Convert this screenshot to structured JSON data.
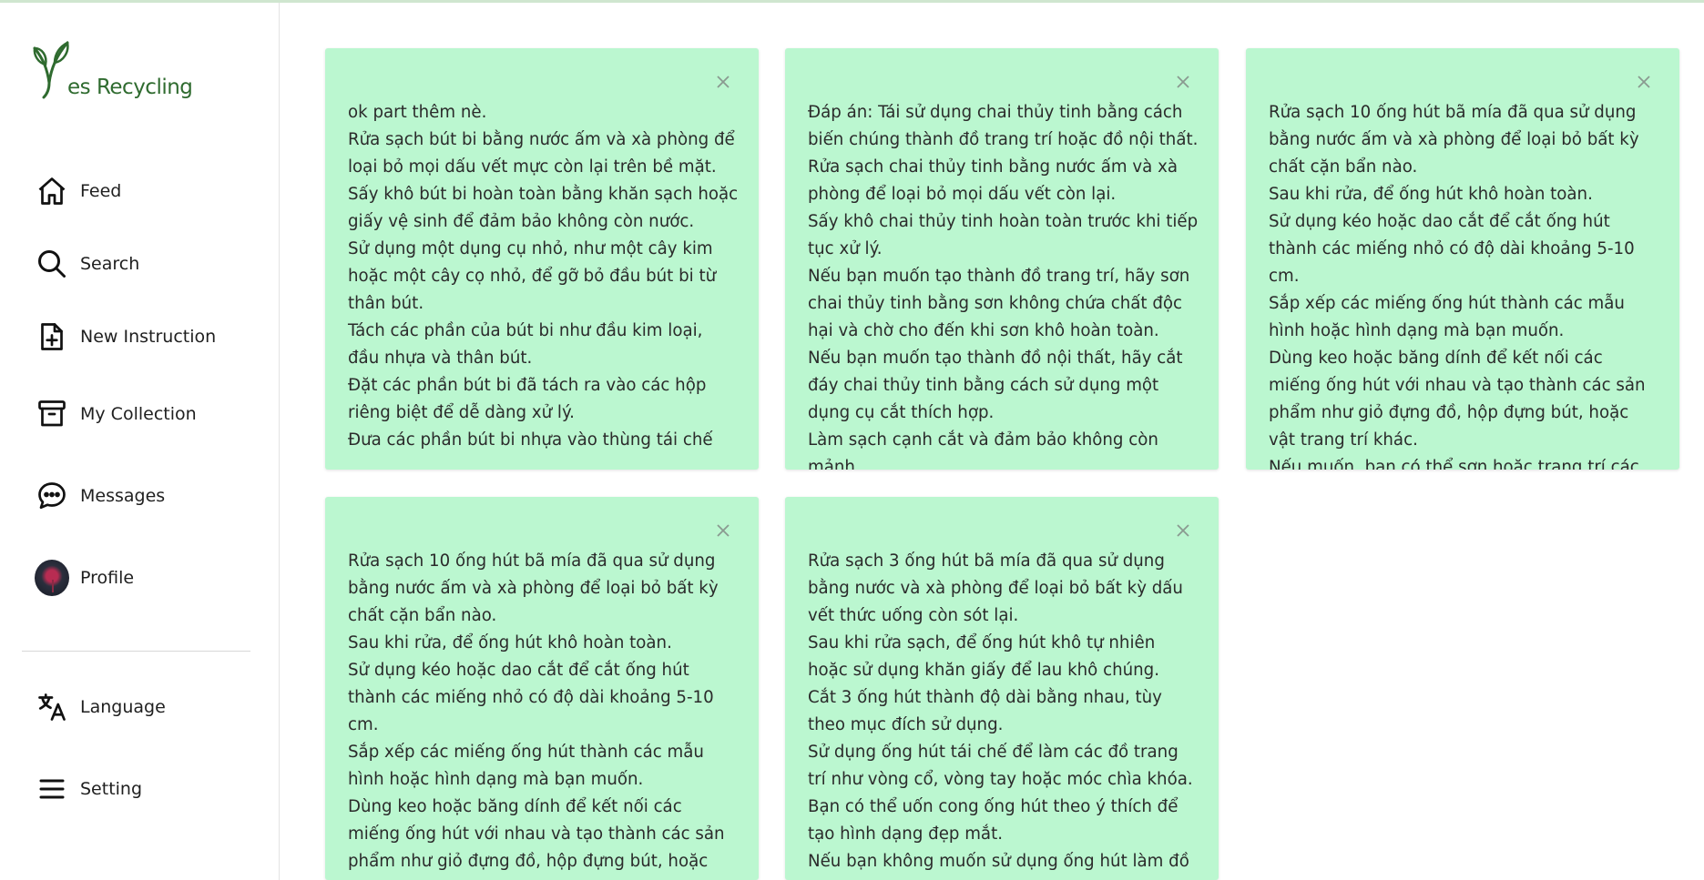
{
  "app": {
    "logo_text": "es Recycling",
    "brand_color": "#2f6b2f",
    "card_color": "#bbf7d0"
  },
  "sidebar": {
    "items": [
      {
        "label": "Feed",
        "icon": "home-icon"
      },
      {
        "label": "Search",
        "icon": "search-icon"
      },
      {
        "label": "New Instruction",
        "icon": "file-plus-icon"
      },
      {
        "label": "My Collection",
        "icon": "archive-icon"
      },
      {
        "label": "Messages",
        "icon": "chat-bubble-icon"
      },
      {
        "label": "Profile",
        "icon": "avatar"
      },
      {
        "label": "Language",
        "icon": "translate-icon"
      },
      {
        "label": "Setting",
        "icon": "menu-icon"
      }
    ]
  },
  "cards": [
    {
      "lines": [
        "ok part thêm nè.",
        "Rửa sạch bút bi bằng nước ấm và xà phòng để loại bỏ mọi dấu vết mực còn lại trên bề mặt.",
        "Sấy khô bút bi hoàn toàn bằng khăn sạch hoặc giấy vệ sinh để đảm bảo không còn nước.",
        "Sử dụng một dụng cụ nhỏ, như một cây kim hoặc một cây cọ nhỏ, để gỡ bỏ đầu bút bi từ thân bút.",
        "Tách các phần của bút bi như đầu kim loại, đầu nhựa và thân bút.",
        "Đặt các phần bút bi đã tách ra vào các hộp riêng biệt để dễ dàng xử lý.",
        "Đưa các phần bút bi nhựa vào thùng tái chế"
      ]
    },
    {
      "lines": [
        "Đáp án: Tái sử dụng chai thủy tinh bằng cách biến chúng thành đồ trang trí hoặc đồ nội thất.",
        "Rửa sạch chai thủy tinh bằng nước ấm và xà phòng để loại bỏ mọi dấu vết còn lại.",
        "Sấy khô chai thủy tinh hoàn toàn trước khi tiếp tục xử lý.",
        "Nếu bạn muốn tạo thành đồ trang trí, hãy sơn chai thủy tinh bằng sơn không chứa chất độc hại và chờ cho đến khi sơn khô hoàn toàn.",
        "Nếu bạn muốn tạo thành đồ nội thất, hãy cắt đáy chai thủy tinh bằng cách sử dụng một dụng cụ cắt thích hợp.",
        "Làm sạch cạnh cắt và đảm bảo không còn mảnh"
      ]
    },
    {
      "lines": [
        "Rửa sạch 10 ống hút bã mía đã qua sử dụng bằng nước ấm và xà phòng để loại bỏ bất kỳ chất cặn bẩn nào.",
        "Sau khi rửa, để ống hút khô hoàn toàn.",
        "Sử dụng kéo hoặc dao cắt để cắt ống hút thành các miếng nhỏ có độ dài khoảng 5-10 cm.",
        "Sắp xếp các miếng ống hút thành các mẫu hình hoặc hình dạng mà bạn muốn.",
        "Dùng keo hoặc băng dính để kết nối các miếng ống hút với nhau và tạo thành các sản phẩm như giỏ đựng đồ, hộp đựng bút, hoặc vật trang trí khác.",
        "Nếu muốn, bạn có thể sơn hoặc trang trí các"
      ]
    },
    {
      "lines": [
        "Rửa sạch 10 ống hút bã mía đã qua sử dụng bằng nước ấm và xà phòng để loại bỏ bất kỳ chất cặn bẩn nào.",
        "Sau khi rửa, để ống hút khô hoàn toàn.",
        "Sử dụng kéo hoặc dao cắt để cắt ống hút thành các miếng nhỏ có độ dài khoảng 5-10 cm.",
        "Sắp xếp các miếng ống hút thành các mẫu hình hoặc hình dạng mà bạn muốn.",
        "Dùng keo hoặc băng dính để kết nối các miếng ống hút với nhau và tạo thành các sản phẩm như giỏ đựng đồ, hộp đựng bút, hoặc vật trang trí khác."
      ]
    },
    {
      "lines": [
        "Rửa sạch 3 ống hút bã mía đã qua sử dụng bằng nước và xà phòng để loại bỏ bất kỳ dấu vết thức uống còn sót lại.",
        "Sau khi rửa sạch, để ống hút khô tự nhiên hoặc sử dụng khăn giấy để lau khô chúng.",
        "Cắt 3 ống hút thành độ dài bằng nhau, tùy theo mục đích sử dụng.",
        "Sử dụng ống hút tái chế để làm các đồ trang trí như vòng cổ, vòng tay hoặc móc chìa khóa. Bạn có thể uốn cong ống hút theo ý thích để tạo hình dạng đẹp mắt.",
        "Nếu bạn không muốn sử dụng ống hút làm đồ"
      ]
    }
  ]
}
